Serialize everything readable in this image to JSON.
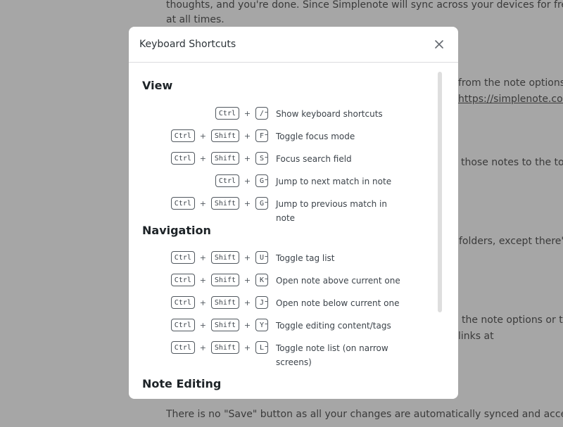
{
  "background": {
    "lines": [
      {
        "text": "thoughts, and you're done. Since Simplenote will sync across your devices for free, you",
        "link": false
      },
      {
        "text": "at all times.",
        "link": false
      },
      {
        "text": "from the note options",
        "link": false
      },
      {
        "text": "https://simplenote.com",
        "link": true
      },
      {
        "text": "those notes to the top",
        "link": false
      },
      {
        "text": "folders, except there's",
        "link": false
      },
      {
        "text": "the note options or ty",
        "link": false
      },
      {
        "text": "links at",
        "link": false
      },
      {
        "text": "There is no \"Save\" button as all your changes are automatically synced and accessible",
        "link": false
      }
    ]
  },
  "modal": {
    "title": "Keyboard Shortcuts",
    "close_icon": "close-icon",
    "sections": [
      {
        "title": "View",
        "shortcuts": [
          {
            "keys": [
              "Ctrl",
              "/"
            ],
            "description": "Show keyboard shortcuts"
          },
          {
            "keys": [
              "Ctrl",
              "Shift",
              "F"
            ],
            "description": "Toggle focus mode"
          },
          {
            "keys": [
              "Ctrl",
              "Shift",
              "S"
            ],
            "description": "Focus search field"
          },
          {
            "keys": [
              "Ctrl",
              "G"
            ],
            "description": "Jump to next match in note"
          },
          {
            "keys": [
              "Ctrl",
              "Shift",
              "G"
            ],
            "description": "Jump to previous match in note"
          }
        ]
      },
      {
        "title": "Navigation",
        "shortcuts": [
          {
            "keys": [
              "Ctrl",
              "Shift",
              "U"
            ],
            "description": "Toggle tag list"
          },
          {
            "keys": [
              "Ctrl",
              "Shift",
              "K"
            ],
            "description": "Open note above current one"
          },
          {
            "keys": [
              "Ctrl",
              "Shift",
              "J"
            ],
            "description": "Open note below current one"
          },
          {
            "keys": [
              "Ctrl",
              "Shift",
              "Y"
            ],
            "description": "Toggle editing content/tags"
          },
          {
            "keys": [
              "Ctrl",
              "Shift",
              "L"
            ],
            "description": "Toggle note list (on narrow screens)"
          }
        ]
      },
      {
        "title": "Note Editing",
        "shortcuts": []
      }
    ],
    "separator": "-",
    "plus": "+"
  }
}
